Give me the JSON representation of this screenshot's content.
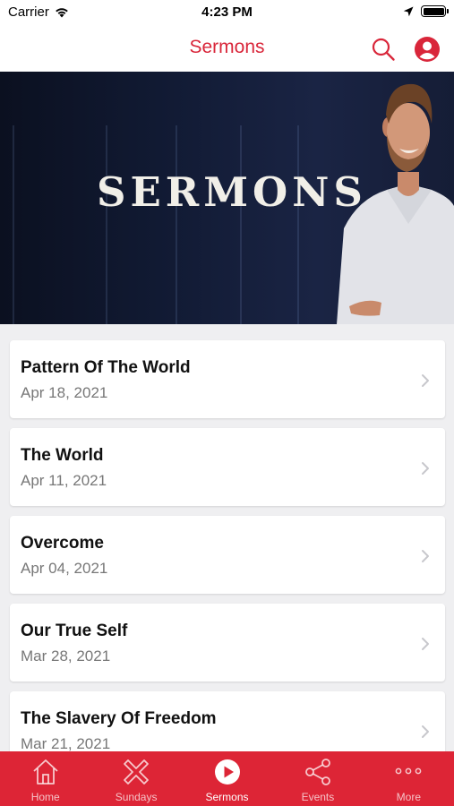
{
  "status": {
    "carrier": "Carrier",
    "time": "4:23 PM"
  },
  "nav": {
    "title": "Sermons"
  },
  "hero": {
    "title": "SERMONS"
  },
  "sermons": [
    {
      "title": "Pattern Of The World",
      "date": "Apr 18, 2021"
    },
    {
      "title": "The World",
      "date": "Apr 11, 2021"
    },
    {
      "title": "Overcome",
      "date": "Apr 04, 2021"
    },
    {
      "title": "Our True Self",
      "date": "Mar 28, 2021"
    },
    {
      "title": "The Slavery Of Freedom",
      "date": "Mar 21, 2021"
    }
  ],
  "tabs": [
    {
      "label": "Home",
      "icon": "home-icon"
    },
    {
      "label": "Sundays",
      "icon": "cross-icon"
    },
    {
      "label": "Sermons",
      "icon": "play-icon",
      "active": true
    },
    {
      "label": "Events",
      "icon": "share-icon"
    },
    {
      "label": "More",
      "icon": "more-icon"
    }
  ],
  "colors": {
    "accent": "#d9263a",
    "tab_bar": "#dd2536"
  }
}
